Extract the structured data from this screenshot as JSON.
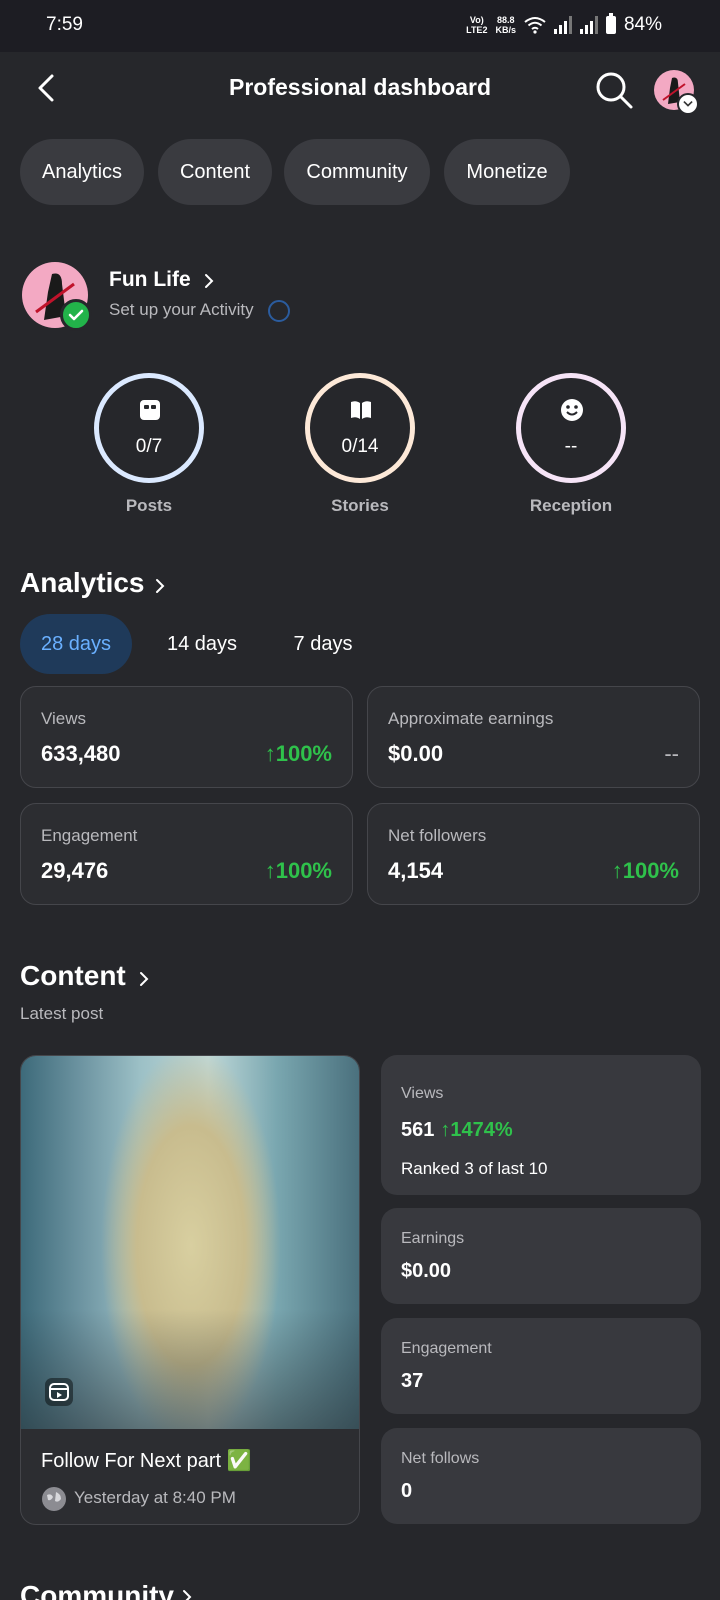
{
  "status": {
    "time": "7:59",
    "net_label_1": "Vo)",
    "net_label_2": "LTE2",
    "speed_value": "88.8",
    "speed_unit": "KB/s",
    "battery": "84%"
  },
  "header": {
    "title": "Professional dashboard"
  },
  "chips": [
    "Analytics",
    "Content",
    "Community",
    "Monetize"
  ],
  "profile": {
    "name": "Fun Life",
    "subtitle": "Set up your Activity"
  },
  "rings": [
    {
      "value": "0/7",
      "label": "Posts",
      "icon": "post-icon",
      "color": "#dbe9ff"
    },
    {
      "value": "0/14",
      "label": "Stories",
      "icon": "book-icon",
      "color": "#fde9d8"
    },
    {
      "value": "--",
      "label": "Reception",
      "icon": "smiley-icon",
      "color": "#f6e4f7"
    }
  ],
  "analytics": {
    "title": "Analytics",
    "tabs": [
      "28 days",
      "14 days",
      "7 days"
    ],
    "active_tab": "28 days",
    "cards": [
      {
        "label": "Views",
        "value": "633,480",
        "delta": "100%"
      },
      {
        "label": "Approximate earnings",
        "value": "$0.00",
        "delta": "--"
      },
      {
        "label": "Engagement",
        "value": "29,476",
        "delta": "100%"
      },
      {
        "label": "Net followers",
        "value": "4,154",
        "delta": "100%"
      }
    ]
  },
  "content": {
    "title": "Content",
    "subtitle": "Latest post",
    "post": {
      "caption": "Follow For Next part ✅",
      "time": "Yesterday at 8:40 PM"
    },
    "stats": {
      "views_label": "Views",
      "views_value": "561",
      "views_delta": "1474%",
      "views_rank": "Ranked 3 of last 10",
      "earnings_label": "Earnings",
      "earnings_value": "$0.00",
      "engagement_label": "Engagement",
      "engagement_value": "37",
      "follows_label": "Net follows",
      "follows_value": "0"
    }
  },
  "community": {
    "title": "Community"
  },
  "colors": {
    "background": "#26272b",
    "positive": "#2fc14b",
    "accent_blue": "#6ab0ff"
  }
}
